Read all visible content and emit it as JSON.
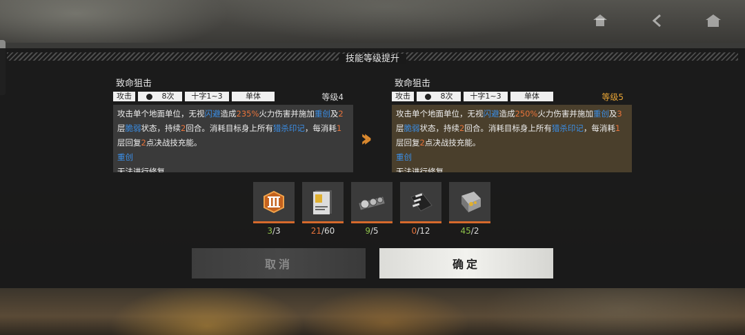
{
  "dialog": {
    "title": "技能等级提升"
  },
  "current": {
    "name": "致命狙击",
    "tags": {
      "type": "攻击",
      "uses": "8次",
      "range": "十字1~3",
      "target": "单体"
    },
    "level": "等级4",
    "desc": {
      "p1": "攻击单个地面单位，无视",
      "k1": "闪避",
      "p2": "造成",
      "v1": "235%",
      "p3": "火力伤害并施加",
      "k2": "重创",
      "p4": "及",
      "v2": "2",
      "p5": "层",
      "k3": "脆弱",
      "p6": "状态，持续",
      "v3": "2",
      "p7": "回合。消耗目标身上所有",
      "k4": "猎杀印记",
      "p8": "，每消耗",
      "v4": "1",
      "p9": "层回复",
      "v5": "2",
      "p10": "点决战技充能。",
      "sub_title": "重创",
      "sub_text": "无法进行修复。"
    }
  },
  "next": {
    "name": "致命狙击",
    "tags": {
      "type": "攻击",
      "uses": "8次",
      "range": "十字1~3",
      "target": "单体"
    },
    "level": "等级5",
    "desc": {
      "p1": "攻击单个地面单位，无视",
      "k1": "闪避",
      "p2": "造成",
      "v1": "250%",
      "p3": "火力伤害并施加",
      "k2": "重创",
      "p4": "及",
      "v2": "3",
      "p5": "层",
      "k3": "脆弱",
      "p6": "状态，持续",
      "v3": "2",
      "p7": "回合。消耗目标身上所有",
      "k4": "猎杀印记",
      "p8": "，每消耗",
      "v4": "1",
      "p9": "层回复",
      "v5": "2",
      "p10": "点决战技充能。",
      "sub_title": "重创",
      "sub_text": "无法进行修复。"
    }
  },
  "materials": [
    {
      "icon": "rank-badge-icon",
      "have": "3",
      "need": "/3",
      "status": "ok"
    },
    {
      "icon": "manual-book-icon",
      "have": "21",
      "need": "/60",
      "status": "bad"
    },
    {
      "icon": "parts-kit-icon",
      "have": "9",
      "need": "/5",
      "status": "ok"
    },
    {
      "icon": "black-parts-icon",
      "have": "0",
      "need": "/12",
      "status": "bad"
    },
    {
      "icon": "supply-crate-icon",
      "have": "45",
      "need": "/2",
      "status": "ok"
    }
  ],
  "buttons": {
    "cancel": "取消",
    "confirm": "确定"
  },
  "colors": {
    "accent_orange": "#e8733a",
    "keyword_blue": "#3a8ee6",
    "ok_green": "#8fc24a",
    "next_level": "#e8a536"
  }
}
